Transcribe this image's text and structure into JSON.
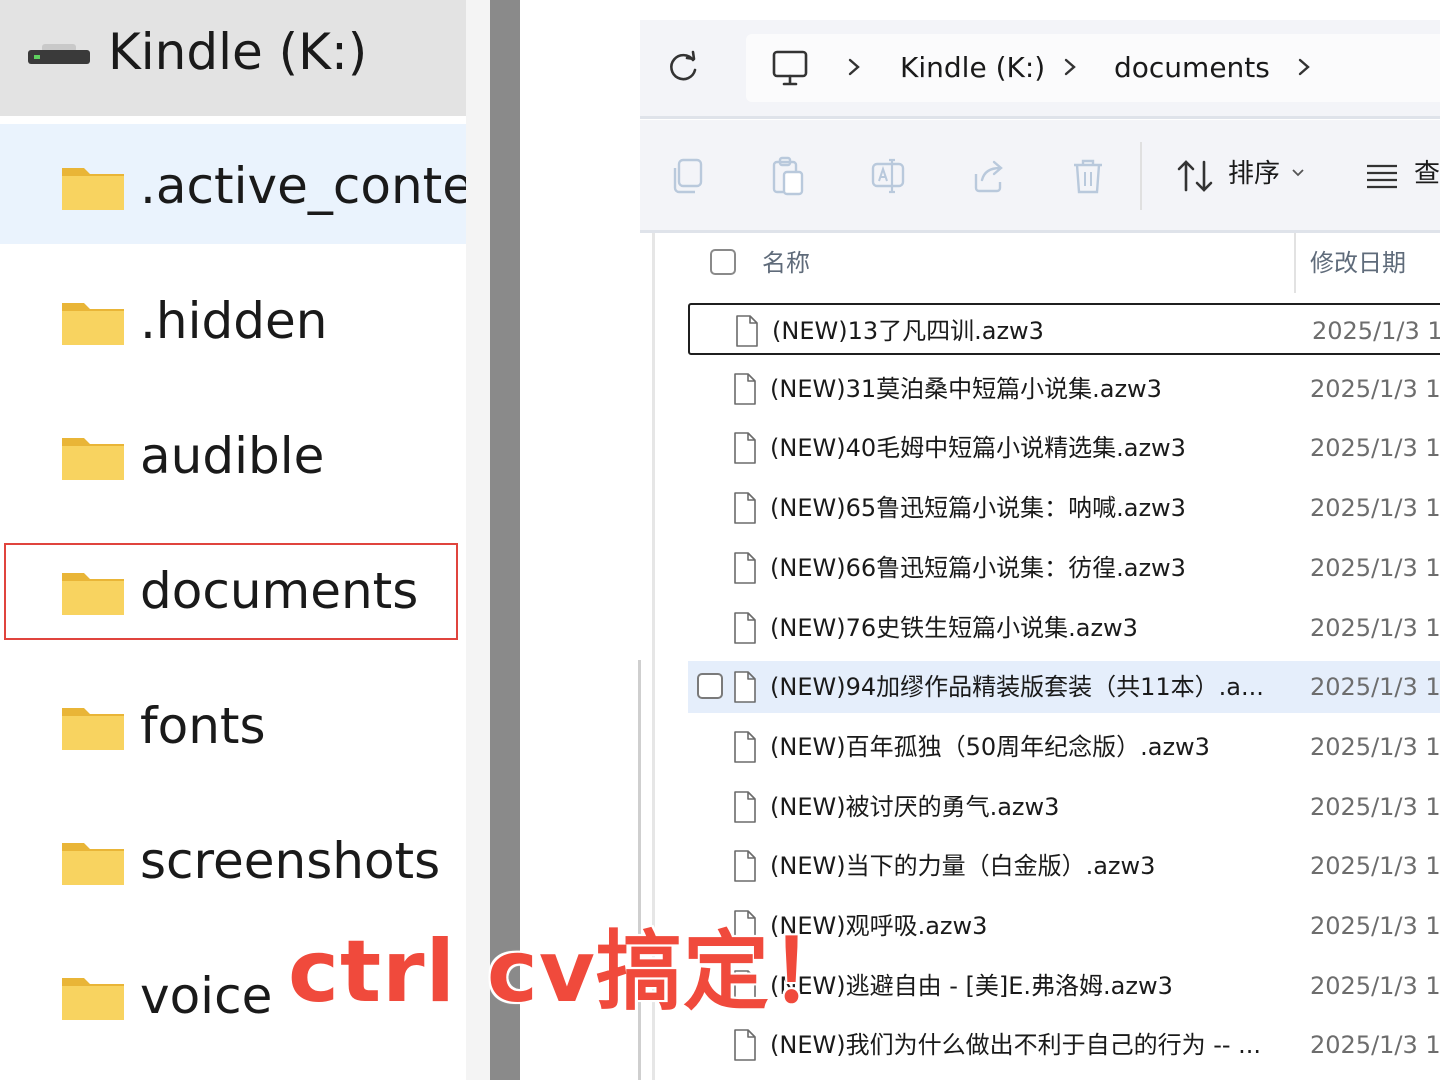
{
  "nav": {
    "drive_label": "Kindle (K:)",
    "folders": [
      {
        "label": ".active_conter",
        "state": "selected"
      },
      {
        "label": ".hidden"
      },
      {
        "label": "audible"
      },
      {
        "label": "documents",
        "state": "highlighted"
      },
      {
        "label": "fonts"
      },
      {
        "label": "screenshots"
      },
      {
        "label": "voice"
      }
    ]
  },
  "address_bar": {
    "refresh_icon": "refresh-icon",
    "pc_icon": "computer-icon",
    "breadcrumbs": [
      "Kindle (K:)",
      "documents"
    ]
  },
  "toolbar": {
    "icons": [
      "copy-icon",
      "paste-icon",
      "rename-icon",
      "share-icon",
      "delete-icon"
    ],
    "sort_label": "排序",
    "view_label": "查"
  },
  "file_list": {
    "header_name": "名称",
    "header_date": "修改日期",
    "rows": [
      {
        "name": "(NEW)13了凡四训.azw3",
        "date": "2025/1/3 1"
      },
      {
        "name": "(NEW)31莫泊桑中短篇小说集.azw3",
        "date": "2025/1/3 1"
      },
      {
        "name": "(NEW)40毛姆中短篇小说精选集.azw3",
        "date": "2025/1/3 1"
      },
      {
        "name": "(NEW)65鲁迅短篇小说集：呐喊.azw3",
        "date": "2025/1/3 1"
      },
      {
        "name": "(NEW)66鲁迅短篇小说集：彷徨.azw3",
        "date": "2025/1/3 1"
      },
      {
        "name": "(NEW)76史铁生短篇小说集.azw3",
        "date": "2025/1/3 1"
      },
      {
        "name": "(NEW)94加缪作品精装版套装（共11本）.a...",
        "date": "2025/1/3 1"
      },
      {
        "name": "(NEW)百年孤独（50周年纪念版）.azw3",
        "date": "2025/1/3 1"
      },
      {
        "name": "(NEW)被讨厌的勇气.azw3",
        "date": "2025/1/3 1"
      },
      {
        "name": "(NEW)当下的力量（白金版）.azw3",
        "date": "2025/1/3 1"
      },
      {
        "name": "(NEW)观呼吸.azw3",
        "date": "2025/1/3 1"
      },
      {
        "name": "(NEW)逃避自由 - [美]E.弗洛姆.azw3",
        "date": "2025/1/3 1"
      },
      {
        "name": "(NEW)我们为什么做出不利于自己的行为 -- ...",
        "date": "2025/1/3 1"
      }
    ]
  },
  "overlay": {
    "caption": "ctrl cv搞定！",
    "color": "#f04a3c"
  },
  "colors": {
    "selected_bg": "#eaf3fd",
    "hover_row_bg": "#e5eefb",
    "highlight_border": "#e0443d",
    "folder_yellow": "#f6c94a"
  }
}
